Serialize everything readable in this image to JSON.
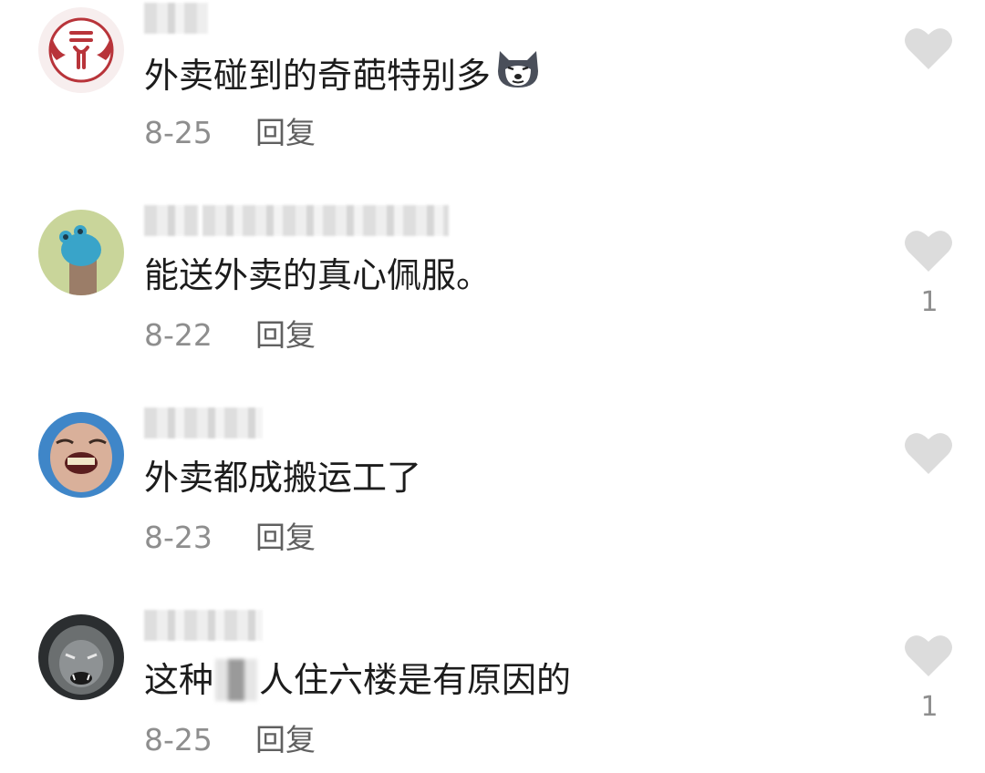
{
  "colors": {
    "text_primary": "#1c1c1c",
    "text_secondary": "#8e8e8e",
    "reply_text": "#606060",
    "like_icon": "#dcdcdc",
    "background": "#ffffff"
  },
  "comments": [
    {
      "text": "外卖碰到的奇葩特别多",
      "trailing_emoji": "husky-dog-emoji",
      "date": "8-25",
      "reply_label": "回复",
      "like_count": ""
    },
    {
      "text": "能送外卖的真心佩服。",
      "date": "8-22",
      "reply_label": "回复",
      "like_count": "1"
    },
    {
      "text": "外卖都成搬运工了",
      "date": "8-23",
      "reply_label": "回复",
      "like_count": ""
    },
    {
      "text_before": "这种",
      "text_after": "人住六楼是有原因的",
      "date": "8-25",
      "reply_label": "回复",
      "like_count": "1"
    }
  ]
}
